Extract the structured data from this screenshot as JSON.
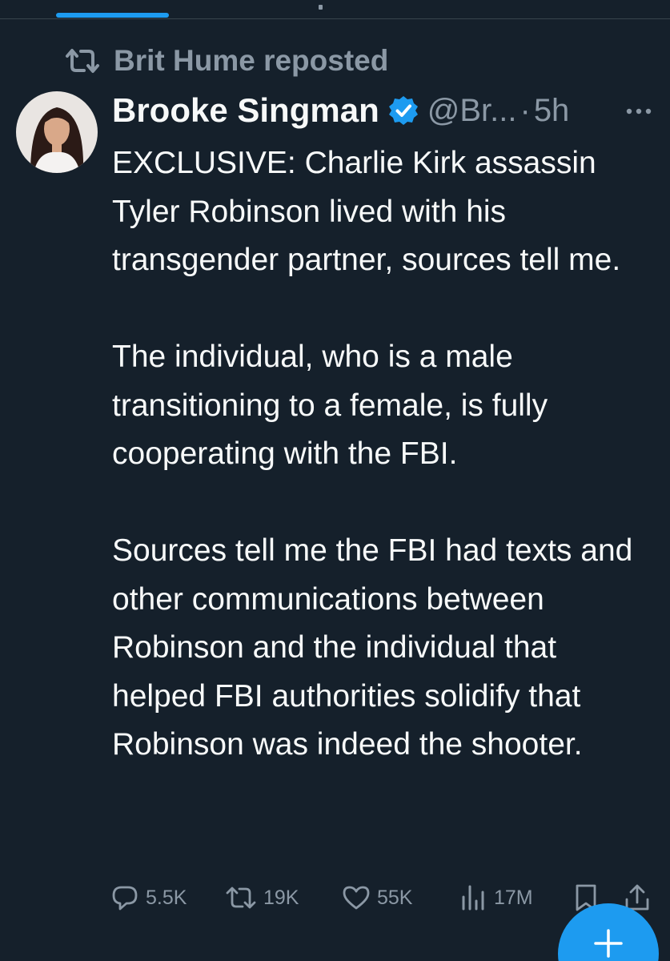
{
  "repost": {
    "label": "Brit Hume reposted"
  },
  "tweet": {
    "author_name": "Brooke Singman",
    "handle": "@Br...",
    "separator": "·",
    "time": "5h",
    "paragraphs": [
      "EXCLUSIVE: Charlie Kirk assassin Tyler Robinson lived with his transgender partner, sources tell me.",
      "The individual, who is a male transitioning to a female, is fully cooperating with the FBI.",
      "Sources tell me the FBI had texts and other communications between Robinson and the individual that helped FBI authorities solidify that Robinson was indeed the shooter."
    ],
    "stats": {
      "replies": "5.5K",
      "reposts": "19K",
      "likes": "55K",
      "views": "17M"
    }
  },
  "icons": {
    "repost": "repost-icon",
    "verified": "verified-badge-icon",
    "more": "more-options-icon",
    "reply": "reply-icon",
    "like": "heart-icon",
    "views": "analytics-icon",
    "bookmark": "bookmark-icon",
    "share": "share-icon",
    "compose": "plus-icon"
  },
  "colors": {
    "background": "#15202b",
    "text_primary": "#f7f9f9",
    "text_secondary": "#8b98a5",
    "accent": "#1d9bf0"
  }
}
